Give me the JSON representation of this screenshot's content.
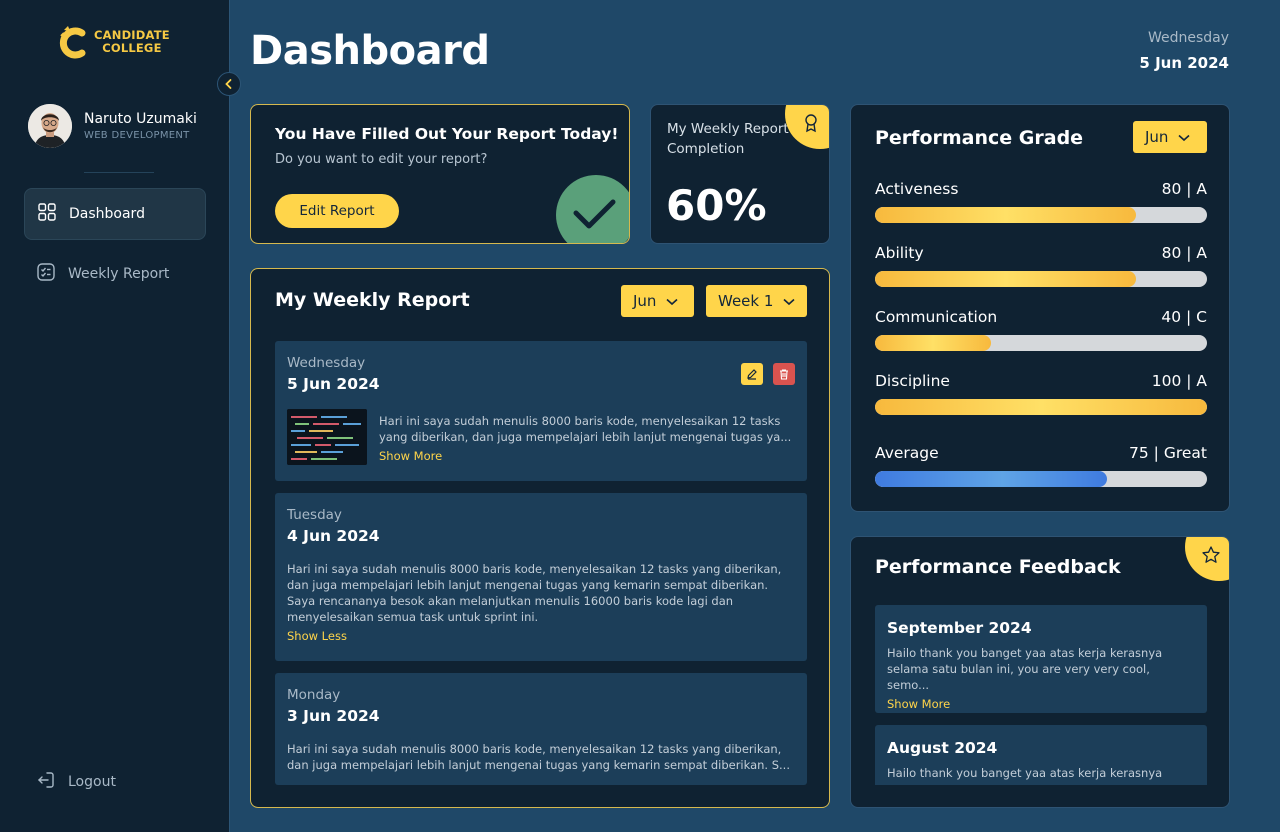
{
  "brand": {
    "line1": "CANDIDATE",
    "line2": "COLLEGE",
    "accent": "#f6c944"
  },
  "profile": {
    "name": "Naruto Uzumaki",
    "role": "WEB DEVELOPMENT"
  },
  "nav": {
    "items": [
      {
        "label": "Dashboard",
        "icon": "grid-icon",
        "active": true
      },
      {
        "label": "Weekly Report",
        "icon": "checklist-icon",
        "active": false
      }
    ],
    "logout": "Logout"
  },
  "header": {
    "title": "Dashboard",
    "day": "Wednesday",
    "date": "5 Jun 2024"
  },
  "filled": {
    "title": "You Have Filled Out Your Report Today!",
    "subtitle": "Do you want to edit your report?",
    "button": "Edit Report"
  },
  "completion": {
    "label": "My Weekly Report Completion",
    "value": "60%",
    "percent": 60
  },
  "weekly": {
    "title": "My Weekly Report",
    "month": "Jun",
    "week": "Week 1",
    "reports": [
      {
        "day": "Wednesday",
        "date": "5 Jun 2024",
        "text": "Hari ini saya sudah menulis 8000 baris kode, menyelesaikan 12 tasks yang diberikan, dan juga mempelajari lebih lanjut mengenai tugas ya...",
        "toggle": "Show More"
      },
      {
        "day": "Tuesday",
        "date": "4 Jun 2024",
        "text": "Hari ini saya sudah menulis 8000 baris kode, menyelesaikan 12 tasks yang diberikan, dan juga mempelajari lebih lanjut mengenai tugas yang kemarin sempat diberikan. Saya rencananya besok akan melanjutkan menulis 16000 baris kode lagi dan menyelesaikan semua task untuk sprint ini.",
        "toggle": "Show Less"
      },
      {
        "day": "Monday",
        "date": "3 Jun 2024",
        "text": "Hari ini saya sudah menulis 8000 baris kode, menyelesaikan 12 tasks yang diberikan, dan juga mempelajari lebih lanjut mengenai tugas yang kemarin sempat diberikan. S..."
      }
    ]
  },
  "grade": {
    "title": "Performance Grade",
    "month": "Jun",
    "rows": [
      {
        "label": "Activeness",
        "value": "80 | A",
        "percent": 78.5
      },
      {
        "label": "Ability",
        "value": "80 | A",
        "percent": 78.5
      },
      {
        "label": "Communication",
        "value": "40 | C",
        "percent": 35
      },
      {
        "label": "Discipline",
        "value": "100 | A",
        "percent": 100
      }
    ],
    "average": {
      "label": "Average",
      "value": "75 | Great",
      "percent": 70
    }
  },
  "feedback": {
    "title": "Performance Feedback",
    "items": [
      {
        "month": "September  2024",
        "text": "Hailo thank you banget yaa atas kerja kerasnya selama satu bulan ini, you are very very cool, semo...",
        "toggle": "Show More"
      },
      {
        "month": "August 2024",
        "text": "Hailo thank you banget yaa atas kerja kerasnya"
      }
    ]
  }
}
